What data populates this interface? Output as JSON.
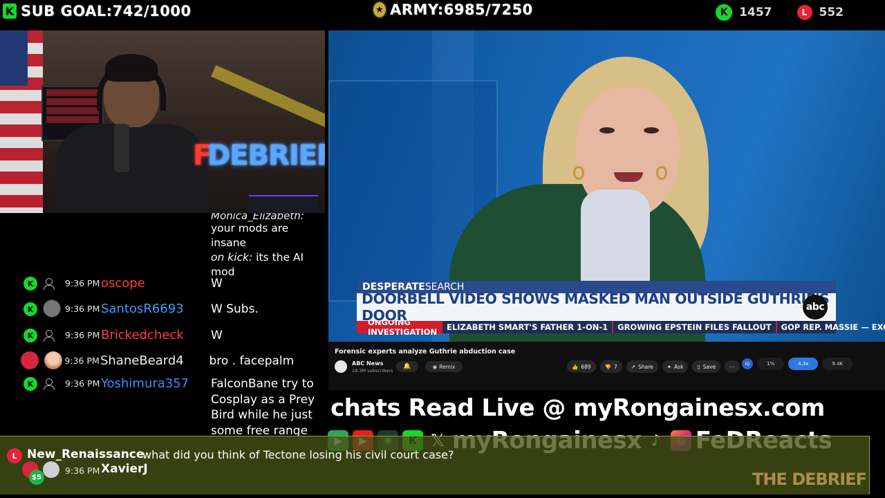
{
  "overlay": {
    "sub_goal": "SUB GOAL:742/1000",
    "army": "ARMY:6985/7250",
    "kick_count": "1457",
    "l_count": "552",
    "kick_letter": "K",
    "l_letter": "L"
  },
  "webcam": {
    "neon_sign": "DEBRIEF",
    "neon_f": "F"
  },
  "chat": {
    "top_message": {
      "user": "Monica_Elizabeth:",
      "line1": "your mods are insane",
      "line2_italic": "on kick:",
      "line2_rest": " its the AI",
      "line3": "mod"
    },
    "messages": [
      {
        "time": "9:36 PM",
        "user": "oscope",
        "color": "#ff3a3a",
        "text": "W"
      },
      {
        "time": "9:36 PM",
        "user": "SantosR6693",
        "color": "#3b9cff",
        "text": "W Subs."
      },
      {
        "time": "9:36 PM",
        "user": "Brickedcheck",
        "color": "#ff3a5a",
        "text": "W"
      },
      {
        "time": "9:36 PM",
        "user": "ShaneBeard4",
        "color": "#ececec",
        "text": "bro . facepalm"
      },
      {
        "time": "9:36 PM",
        "user": "Yoshimura357",
        "color": "#3b8cff",
        "text": "FalconBane try to Cosplay as a Prey Bird while he just some free range chicken"
      }
    ]
  },
  "video": {
    "lower_third_kicker_bold": "DESPERATE",
    "lower_third_kicker": " SEARCH",
    "headline": "DOORBELL VIDEO SHOWS MASKED MAN OUTSIDE GUTHRIE'S DOOR",
    "network_logo": "abc",
    "ticker_label": "ONGOING INVESTIGATION",
    "ticker_items": [
      "ELIZABETH SMART'S FATHER 1-ON-1",
      "GROWING EPSTEIN FILES FALLOUT",
      "GOP REP. MASSIE — EXCLUSIVE"
    ]
  },
  "youtube": {
    "title": "Forensic experts analyze Guthrie abduction case",
    "channel": "ABC News",
    "subscribers": "19.3M subscribers",
    "remix": "Remix",
    "likes": "689",
    "dislikes": "7",
    "share": "Share",
    "ask": "Ask",
    "save": "Save",
    "iq": "IQ",
    "stats": [
      "1%",
      "4.3x",
      "9.4K"
    ]
  },
  "branding": {
    "chats_line": "chats Read Live @ myRongainesx.com",
    "handle1": "myRongainesx",
    "handle2": "FeDReacts"
  },
  "bottom_chat": {
    "user": "New_Renaissance",
    "message": "what did you think of Tectone losing his civil court case?",
    "donation": "$5",
    "time": "9:36 PM",
    "user2": "XavierJ",
    "logo": "THE DEBRIEF"
  }
}
